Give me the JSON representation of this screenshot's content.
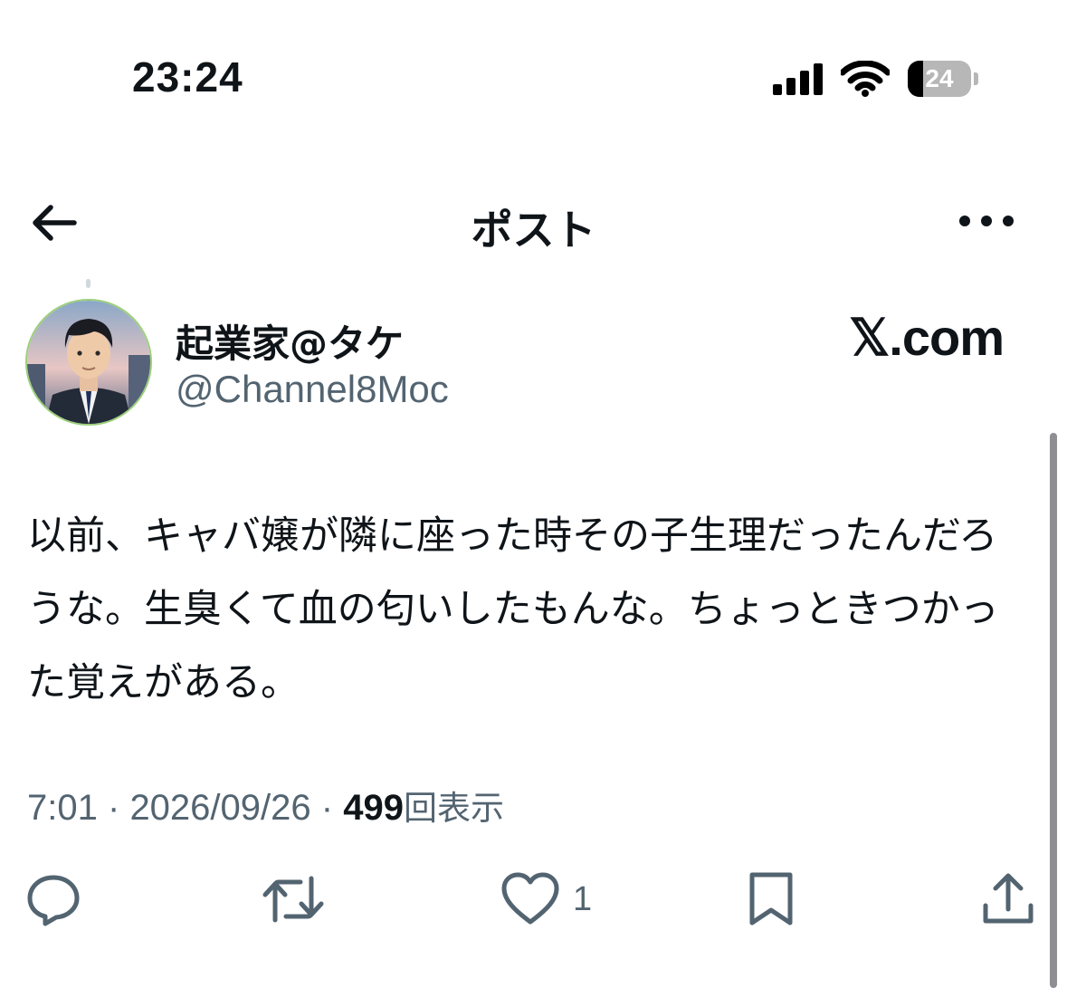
{
  "status_bar": {
    "time": "23:24",
    "battery_level": "24",
    "battery_fraction": 0.24
  },
  "nav": {
    "title": "ポスト",
    "back_icon": "arrow-left-icon",
    "more_icon": "more-horizontal-icon"
  },
  "author": {
    "display_name": "起業家@タケ",
    "handle": "@Channel8Moc"
  },
  "watermark": "𝕏.com",
  "post": {
    "text": "以前、キャバ嬢が隣に座った時その子生理だったんだろうな。生臭くて血の匂いしたもんな。ちょっときつかった覚えがある。",
    "time": "7:01",
    "separator": "·",
    "date": "2026/09/26",
    "views_count": "499",
    "views_label": "回表示"
  },
  "actions": {
    "reply_icon": "reply-icon",
    "repost_icon": "repost-icon",
    "like_icon": "heart-icon",
    "like_count": "1",
    "bookmark_icon": "bookmark-icon",
    "share_icon": "share-icon"
  },
  "colors": {
    "text_primary": "#0f1419",
    "text_secondary": "#536471",
    "icon": "#536471",
    "scrollbar": "#8e8e93"
  }
}
